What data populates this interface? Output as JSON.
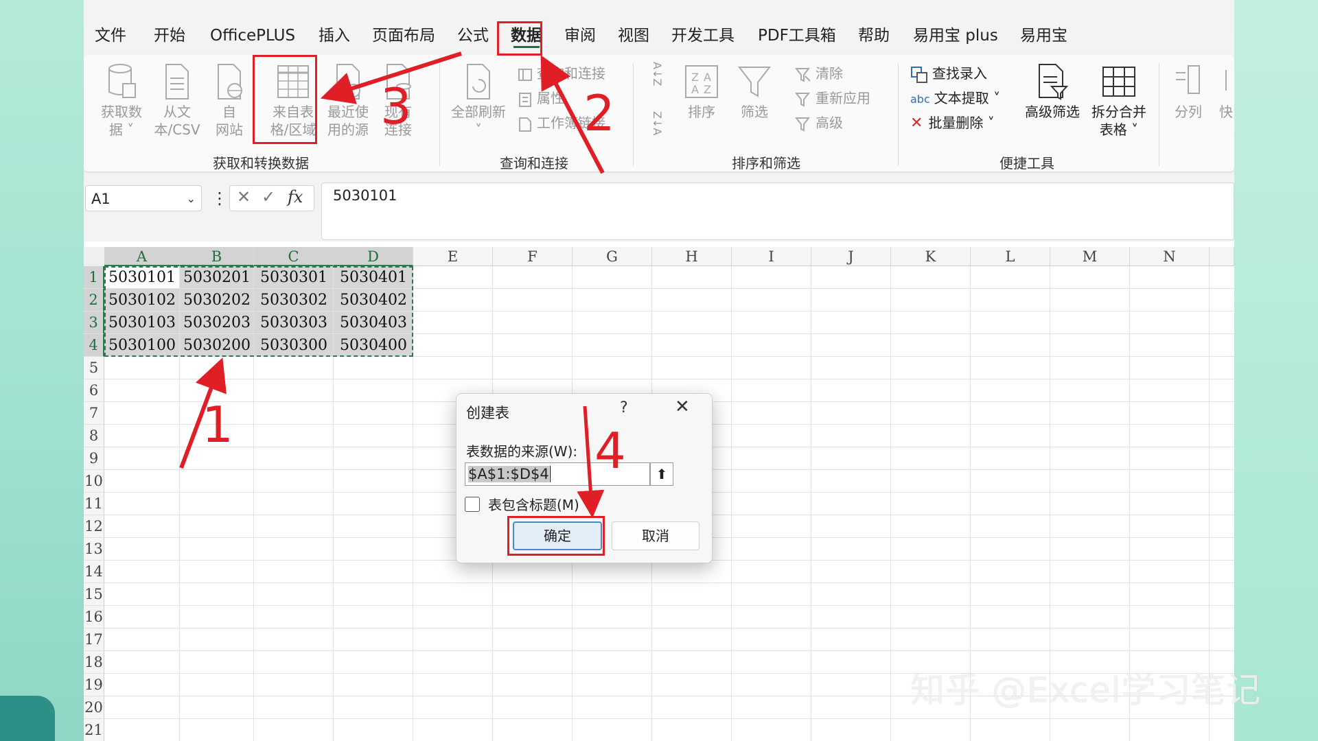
{
  "menu": {
    "items": [
      "文件",
      "开始",
      "OfficePLUS",
      "插入",
      "页面布局",
      "公式",
      "数据",
      "审阅",
      "视图",
      "开发工具",
      "PDF工具箱",
      "帮助",
      "易用宝 plus",
      "易用宝"
    ],
    "active": "数据"
  },
  "ribbon": {
    "get_data": "获取数\n据 ˅",
    "from_text_csv": "从文\n本/CSV",
    "from_web": "自\n网站",
    "from_table_range": "来自表\n格/区域",
    "recent_sources": "最近使\n用的源",
    "existing_connections": "现有\n连接",
    "refresh_all": "全部刷新\n˅",
    "queries_connections": "查询和连接",
    "properties": "属性",
    "workbook_links": "工作簿链接",
    "sort_az": "A↓Z",
    "sort_za": "Z↓A",
    "sort": "排序",
    "filter": "筛选",
    "clear": "清除",
    "reapply": "重新应用",
    "advanced": "高级",
    "lookup_entry": "查找录入",
    "text_extract": "文本提取 ˅",
    "batch_delete": "批量删除 ˅",
    "advanced_filter": "高级筛选",
    "split_merge": "拆分合并\n表格 ˅",
    "split_col": "分列",
    "quick": "快",
    "groups": {
      "get_transform": "获取和转换数据",
      "queries": "查询和连接",
      "sort_filter": "排序和筛选",
      "quick_tools": "便捷工具"
    }
  },
  "formula_bar": {
    "name_box": "A1",
    "fx": "fx",
    "value": "5030101"
  },
  "sheet": {
    "columns": [
      "A",
      "B",
      "C",
      "D",
      "E",
      "F",
      "G",
      "H",
      "I",
      "J",
      "K",
      "L",
      "M",
      "N"
    ],
    "rows": [
      "1",
      "2",
      "3",
      "4",
      "5",
      "6",
      "7",
      "8",
      "9",
      "10",
      "11",
      "12",
      "13",
      "14",
      "15",
      "16",
      "17",
      "18",
      "19",
      "20",
      "21"
    ],
    "cells": [
      [
        "5030101",
        "5030201",
        "5030301",
        "5030401"
      ],
      [
        "5030102",
        "5030202",
        "5030302",
        "5030402"
      ],
      [
        "5030103",
        "5030203",
        "5030303",
        "5030403"
      ],
      [
        "5030100",
        "5030200",
        "5030300",
        "5030400"
      ]
    ]
  },
  "dialog": {
    "title": "创建表",
    "help": "?",
    "close": "✕",
    "source_label": "表数据的来源(W):",
    "source_value": "$A$1:$D$4",
    "has_headers_label": "表包含标题(M)",
    "has_headers_checked": false,
    "ok": "确定",
    "cancel": "取消"
  },
  "annotations": {
    "step1": "1",
    "step2": "2",
    "step3": "3",
    "step4": "4",
    "color": "#e01e26"
  },
  "watermark": "知乎 @Excel学习笔记",
  "colors": {
    "accent_green": "#1e7145",
    "annotation_red": "#e01e26",
    "background_mint": "#a9e4d6"
  }
}
